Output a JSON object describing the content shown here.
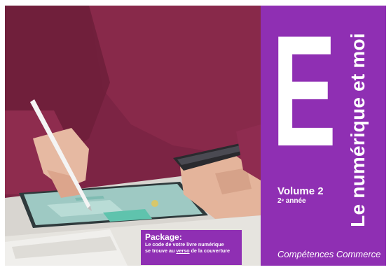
{
  "cover": {
    "letter": "E",
    "title": "Le numérique et moi",
    "volume": "Volume 2",
    "year_number": "2",
    "year_suffix": "e",
    "year_word": "année",
    "subject": "Compétences Commerce",
    "package": {
      "title": "Package:",
      "line1": "Le code de votre livre numérique",
      "line2_before": "se trouve au ",
      "line2_bold": "verso",
      "line2_after": " de la couverture"
    },
    "colors": {
      "brand": "#8f2fb3",
      "text": "#ffffff"
    },
    "photo_description_icons": [
      "tablet",
      "stylus",
      "smartphone",
      "hands"
    ]
  }
}
